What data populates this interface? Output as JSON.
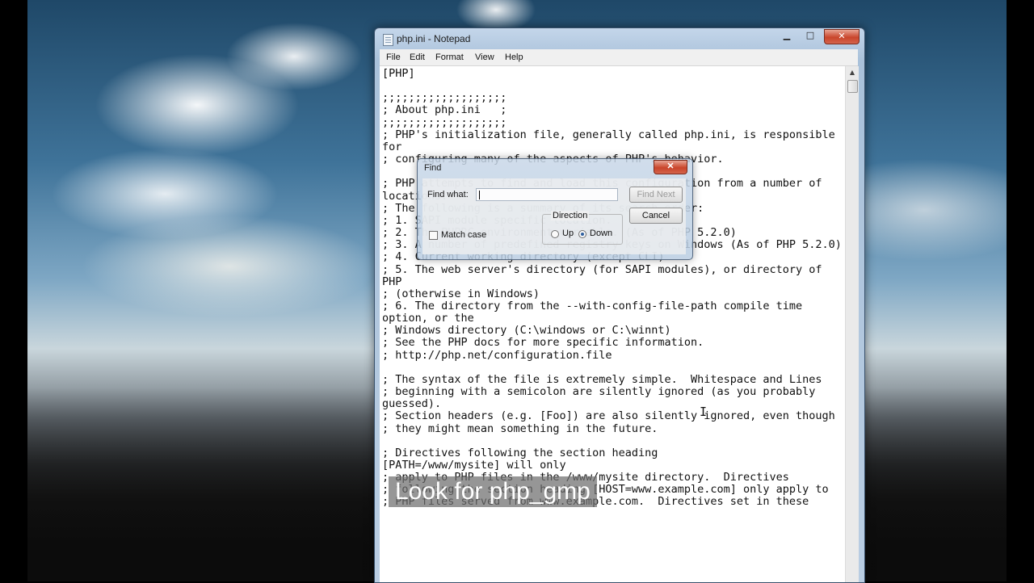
{
  "window": {
    "title": "php.ini - Notepad",
    "controls": {
      "minimize": "▁",
      "maximize": "□",
      "close": "✕"
    }
  },
  "menu": [
    "File",
    "Edit",
    "Format",
    "View",
    "Help"
  ],
  "editor": {
    "text": "[PHP]\n\n;;;;;;;;;;;;;;;;;;;\n; About php.ini   ;\n;;;;;;;;;;;;;;;;;;;\n; PHP's initialization file, generally called php.ini, is responsible for\n; configuring many of the aspects of PHP's behavior.\n\n; PHP attempts to find and load this configuration from a number of locations.\n; The following is a summary of its search order:\n; 1. SAPI module specific location.\n; 2. The PHPRC environment variable. (As of PHP 5.2.0)\n; 3. A number of predefined registry keys on Windows (As of PHP 5.2.0)\n; 4. Current working directory (except CLI)\n; 5. The web server's directory (for SAPI modules), or directory of PHP\n; (otherwise in Windows)\n; 6. The directory from the --with-config-file-path compile time option, or the\n; Windows directory (C:\\windows or C:\\winnt)\n; See the PHP docs for more specific information.\n; http://php.net/configuration.file\n\n; The syntax of the file is extremely simple.  Whitespace and Lines\n; beginning with a semicolon are silently ignored (as you probably guessed).\n; Section headers (e.g. [Foo]) are also silently ignored, even though\n; they might mean something in the future.\n\n; Directives following the section heading\n[PATH=/www/mysite] will only\n; apply to PHP files in the /www/mysite directory.  Directives\n; following the section heading [HOST=www.example.com] only apply to\n; PHP files served from www.example.com.  Directives set in these"
  },
  "find_dialog": {
    "title": "Find",
    "close": "✕",
    "find_what_label": "Find what:",
    "find_what_value": "",
    "find_next": "Find Next",
    "cancel": "Cancel",
    "direction_label": "Direction",
    "up_label": "Up",
    "down_label": "Down",
    "direction_selected": "Down",
    "match_case_label": "Match case",
    "match_case_checked": false
  },
  "caption": "Look for php_gmp"
}
